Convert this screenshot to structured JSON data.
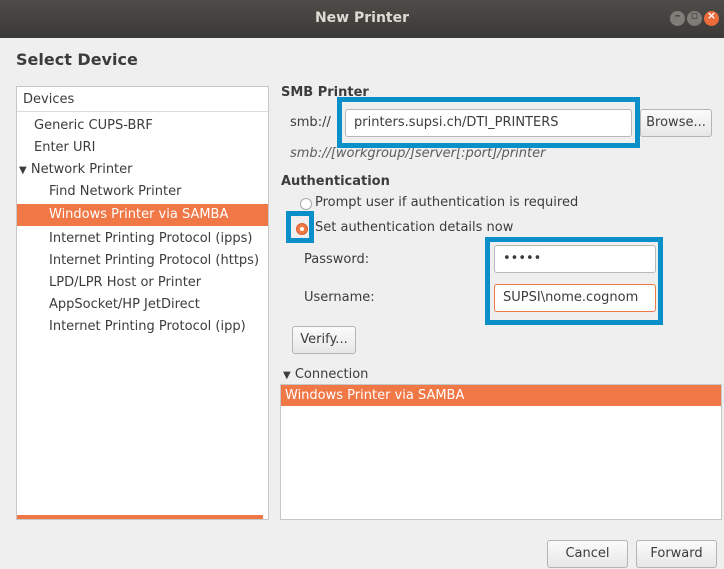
{
  "window": {
    "title": "New Printer"
  },
  "heading": "Select Device",
  "devices": {
    "header": "Devices",
    "items": [
      "Generic CUPS-BRF",
      "Enter URI",
      "Network Printer",
      "Find Network Printer",
      "Windows Printer via SAMBA",
      "Internet Printing Protocol (ipps)",
      "Internet Printing Protocol (https)",
      "LPD/LPR Host or Printer",
      "AppSocket/HP JetDirect",
      "Internet Printing Protocol (ipp)"
    ],
    "selected": "Windows Printer via SAMBA",
    "expander_glyph": "▼"
  },
  "smb": {
    "section": "SMB Printer",
    "prefix": "smb://",
    "value": "printers.supsi.ch/DTI_PRINTERS",
    "browse": "Browse...",
    "hint": "smb://[workgroup/]server[:port]/printer"
  },
  "auth": {
    "section": "Authentication",
    "option_prompt": "Prompt user if authentication is required",
    "option_set": "Set authentication details now",
    "password_label": "Password:",
    "password_value": "•••••",
    "username_label": "Username:",
    "username_value": "SUPSI\\nome.cognom",
    "verify": "Verify..."
  },
  "connection": {
    "expander_glyph": "▼",
    "label": "Connection",
    "selected": "Windows Printer via SAMBA"
  },
  "footer": {
    "cancel": "Cancel",
    "forward": "Forward"
  },
  "colors": {
    "accent": "#f07746",
    "highlight": "#0b8fc9",
    "titlebar": "#3b3a37"
  }
}
